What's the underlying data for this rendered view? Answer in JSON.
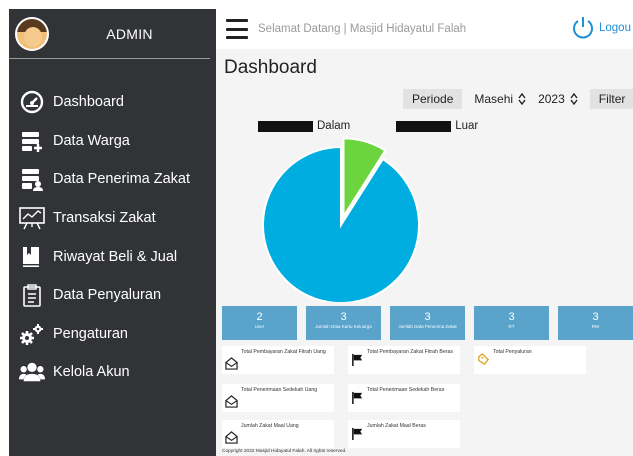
{
  "sidebar": {
    "admin_label": "ADMIN",
    "items": [
      {
        "label": "Dashboard",
        "icon": "dashboard-gauge-icon"
      },
      {
        "label": "Data Warga",
        "icon": "database-add-icon"
      },
      {
        "label": "Data Penerima Zakat",
        "icon": "database-user-icon"
      },
      {
        "label": "Transaksi Zakat",
        "icon": "presentation-chart-icon"
      },
      {
        "label": "Riwayat Beli & Jual",
        "icon": "book-icon"
      },
      {
        "label": "Data Penyaluran",
        "icon": "clipboard-icon"
      },
      {
        "label": "Pengaturan",
        "icon": "gears-icon"
      },
      {
        "label": "Kelola Akun",
        "icon": "users-icon"
      }
    ]
  },
  "topbar": {
    "welcome": "Selamat Datang | Masjid Hidayatul Falah",
    "logout_label": "Logou"
  },
  "page_title": "Dashboard",
  "filters": {
    "periode_label": "Periode",
    "calendar_value": "Masehi",
    "year_value": "2023",
    "filter_label": "Filter"
  },
  "chart_data": {
    "type": "pie",
    "labels": [
      "Dalam",
      "Luar"
    ],
    "values": [
      91,
      9
    ],
    "colors": [
      "#00ade0",
      "#6cd43c"
    ],
    "legend_swatch_color": "#111111",
    "legend_position": "top"
  },
  "stats": [
    {
      "value": "2",
      "label": "User"
    },
    {
      "value": "3",
      "label": "Jumlah Data Kartu Keluarga"
    },
    {
      "value": "3",
      "label": "Jumlah Data Penerima Zakat"
    },
    {
      "value": "3",
      "label": "RT"
    },
    {
      "value": "3",
      "label": "RW"
    }
  ],
  "cards": {
    "c1": "Total Pembayaran Zakat Fitrah Uang",
    "c2": "Total Pembayaran Zakat Fitrah Beras",
    "c3": "Total Penyaluran",
    "c4": "Total Penerimaan Sedekah Uang",
    "c5": "Total Penerimaan Sedekah Beras",
    "c6": "Jumlah Zakat Maal Uang",
    "c7": "Jumlah Zakat Maal Beras"
  },
  "footer": "Copyright    2022 Masjid Hidayatul Falah. All rights reserved."
}
